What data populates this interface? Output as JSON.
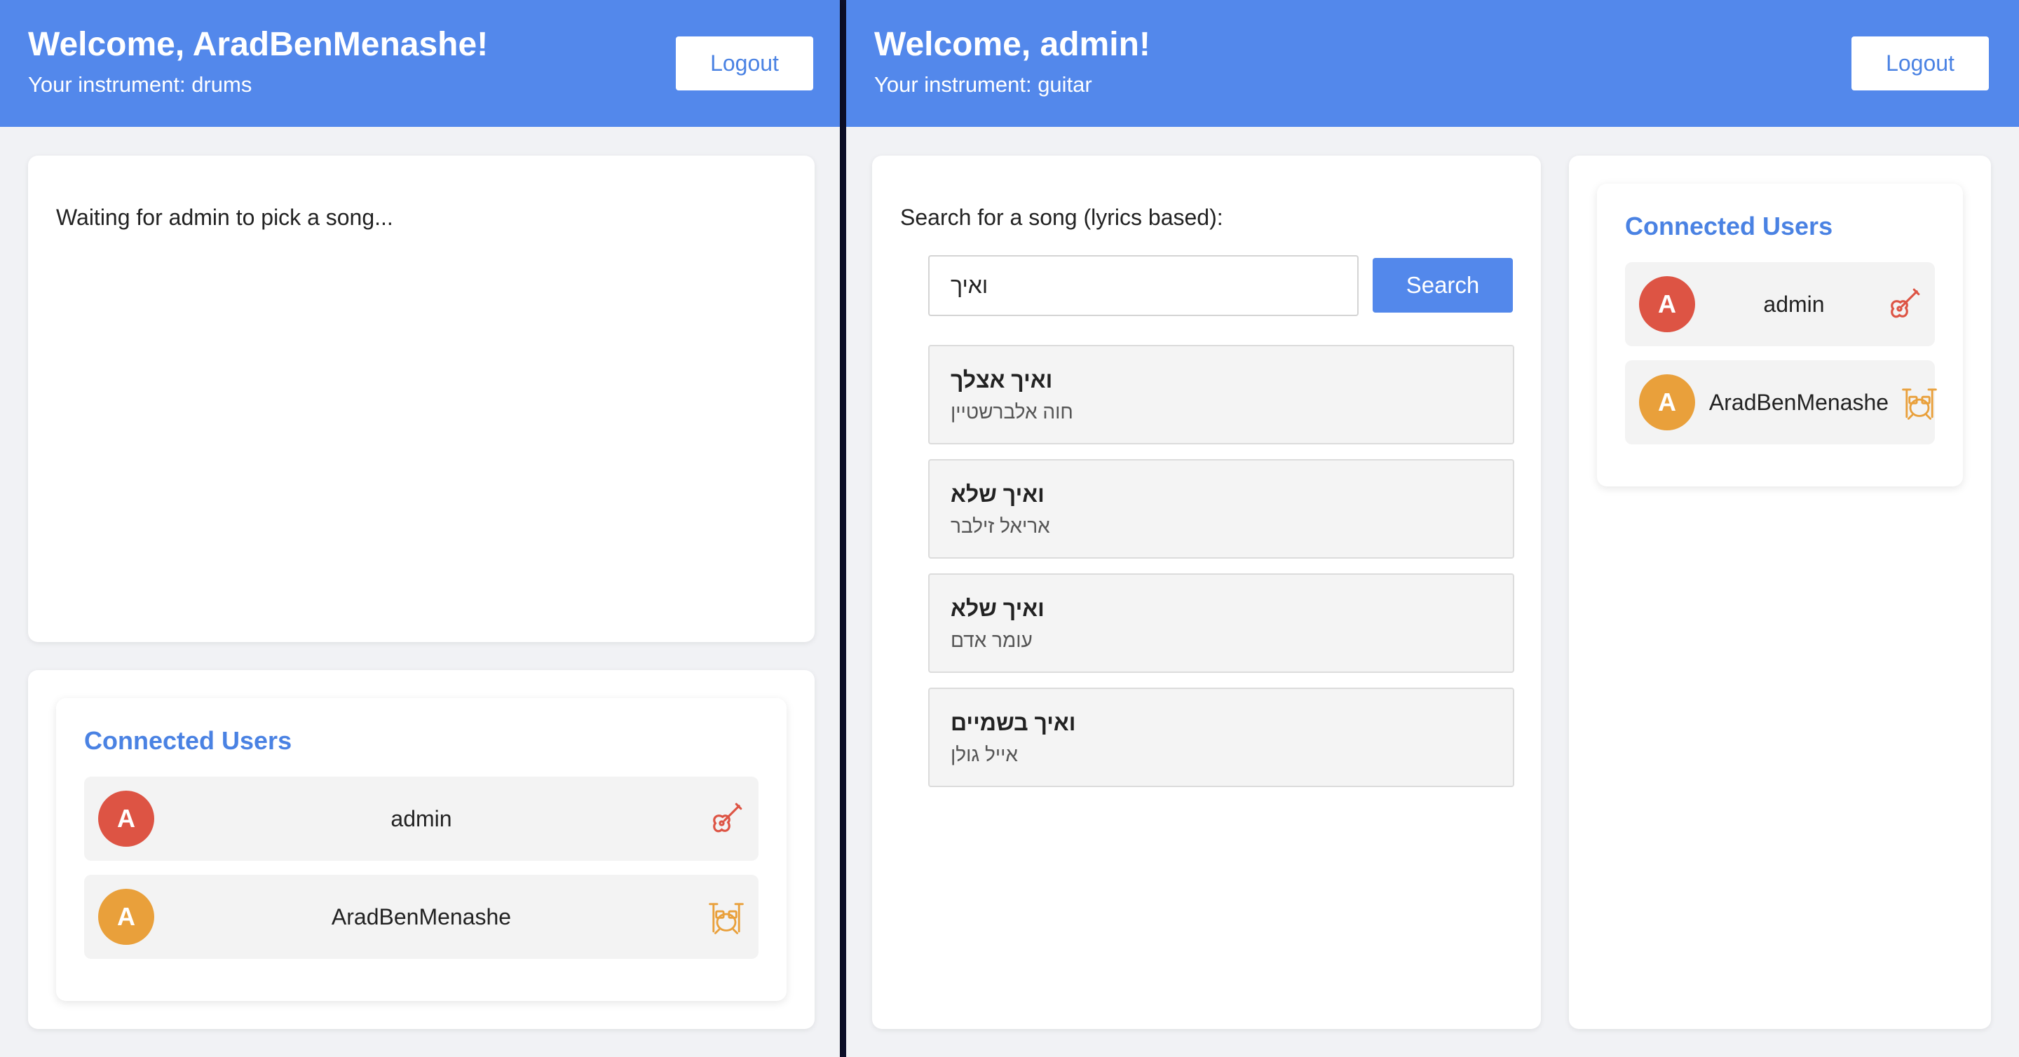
{
  "left_window": {
    "header": {
      "welcome": "Welcome, AradBenMenashe!",
      "instrument": "Your instrument: drums",
      "logout_label": "Logout"
    },
    "waiting_text": "Waiting for admin to pick a song...",
    "connected_users": {
      "title": "Connected Users",
      "users": [
        {
          "initial": "A",
          "name": "admin",
          "color": "#dd5444",
          "icon": "guitar-icon"
        },
        {
          "initial": "A",
          "name": "AradBenMenashe",
          "color": "#e9a03b",
          "icon": "drums-icon"
        }
      ]
    }
  },
  "right_window": {
    "header": {
      "welcome": "Welcome, admin!",
      "instrument": "Your instrument: guitar",
      "logout_label": "Logout"
    },
    "search": {
      "label": "Search for a song (lyrics based):",
      "value": "ואיך",
      "button_label": "Search"
    },
    "results": [
      {
        "title": "ואיך אצלך",
        "artist": "חוה אלברשטיין"
      },
      {
        "title": "ואיך שלא",
        "artist": "אריאל זילבר"
      },
      {
        "title": "ואיך שלא",
        "artist": "עומר אדם"
      },
      {
        "title": "ואיך בשמיים",
        "artist": "אייל גולן"
      }
    ],
    "connected_users": {
      "title": "Connected Users",
      "users": [
        {
          "initial": "A",
          "name": "admin",
          "color": "#dd5444",
          "icon": "guitar-icon"
        },
        {
          "initial": "A",
          "name": "AradBenMenashe",
          "color": "#e9a03b",
          "icon": "drums-icon"
        }
      ]
    }
  },
  "colors": {
    "accent": "#5388eb",
    "guitar": "#dd5444",
    "drums": "#e9a03b"
  }
}
